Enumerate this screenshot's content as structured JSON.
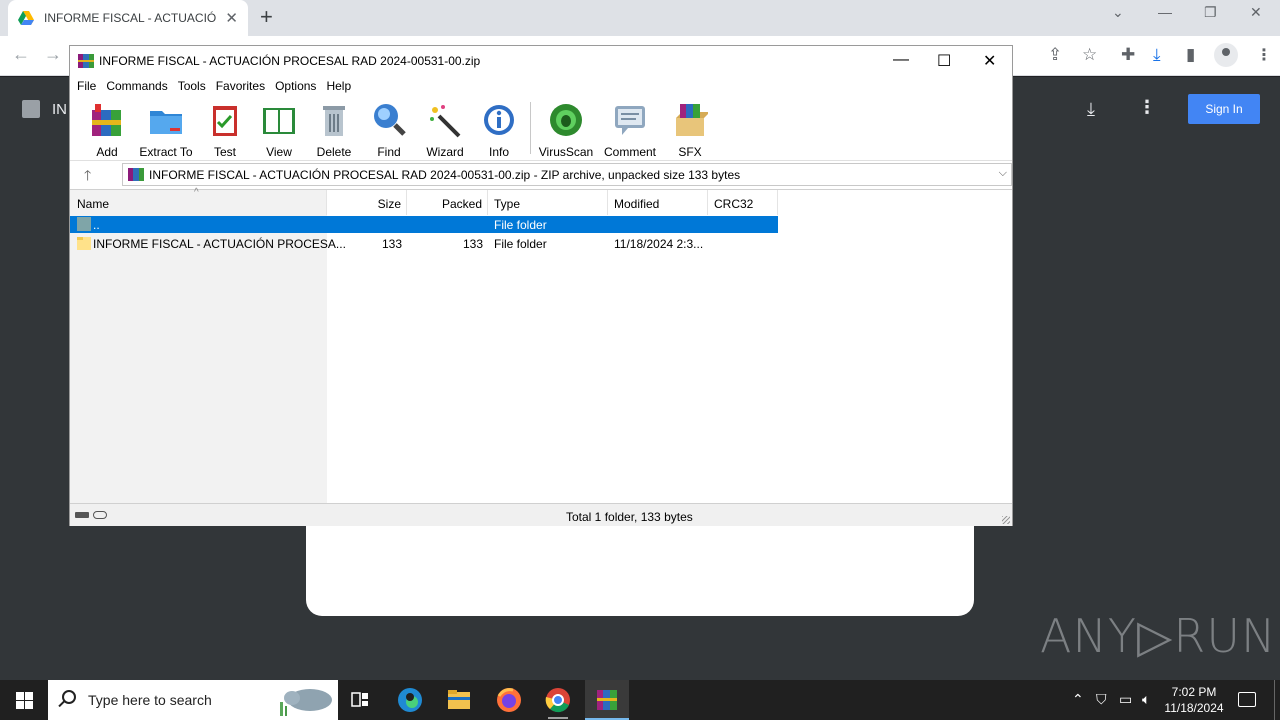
{
  "browser": {
    "tab_title": "INFORME FISCAL - ACTUACIÓN PROCESAL RAD 2024-00531-00.zip",
    "page_title_fragment": "IN",
    "sign_in_label": "Sign In",
    "watermark": "ANY▷RUN"
  },
  "winrar": {
    "title": "INFORME FISCAL - ACTUACIÓN PROCESAL RAD 2024-00531-00.zip",
    "menu": [
      "File",
      "Commands",
      "Tools",
      "Favorites",
      "Options",
      "Help"
    ],
    "toolbar": [
      "Add",
      "Extract To",
      "Test",
      "View",
      "Delete",
      "Find",
      "Wizard",
      "Info",
      "VirusScan",
      "Comment",
      "SFX"
    ],
    "address": "INFORME FISCAL - ACTUACIÓN PROCESAL RAD 2024-00531-00.zip - ZIP archive, unpacked size 133 bytes",
    "columns": [
      "Name",
      "Size",
      "Packed",
      "Type",
      "Modified",
      "CRC32"
    ],
    "rows": [
      {
        "name": "..",
        "size": "",
        "packed": "",
        "type": "File folder",
        "modified": "",
        "crc": ""
      },
      {
        "name": "INFORME FISCAL - ACTUACIÓN PROCESA...",
        "size": "133",
        "packed": "133",
        "type": "File folder",
        "modified": "11/18/2024 2:3...",
        "crc": ""
      }
    ],
    "status": "Total 1 folder, 133 bytes"
  },
  "taskbar": {
    "search_placeholder": "Type here to search",
    "time": "7:02 PM",
    "date": "11/18/2024"
  },
  "colors": {
    "selection": "#0078d7",
    "signin": "#4285f4",
    "taskbar": "#202020"
  }
}
